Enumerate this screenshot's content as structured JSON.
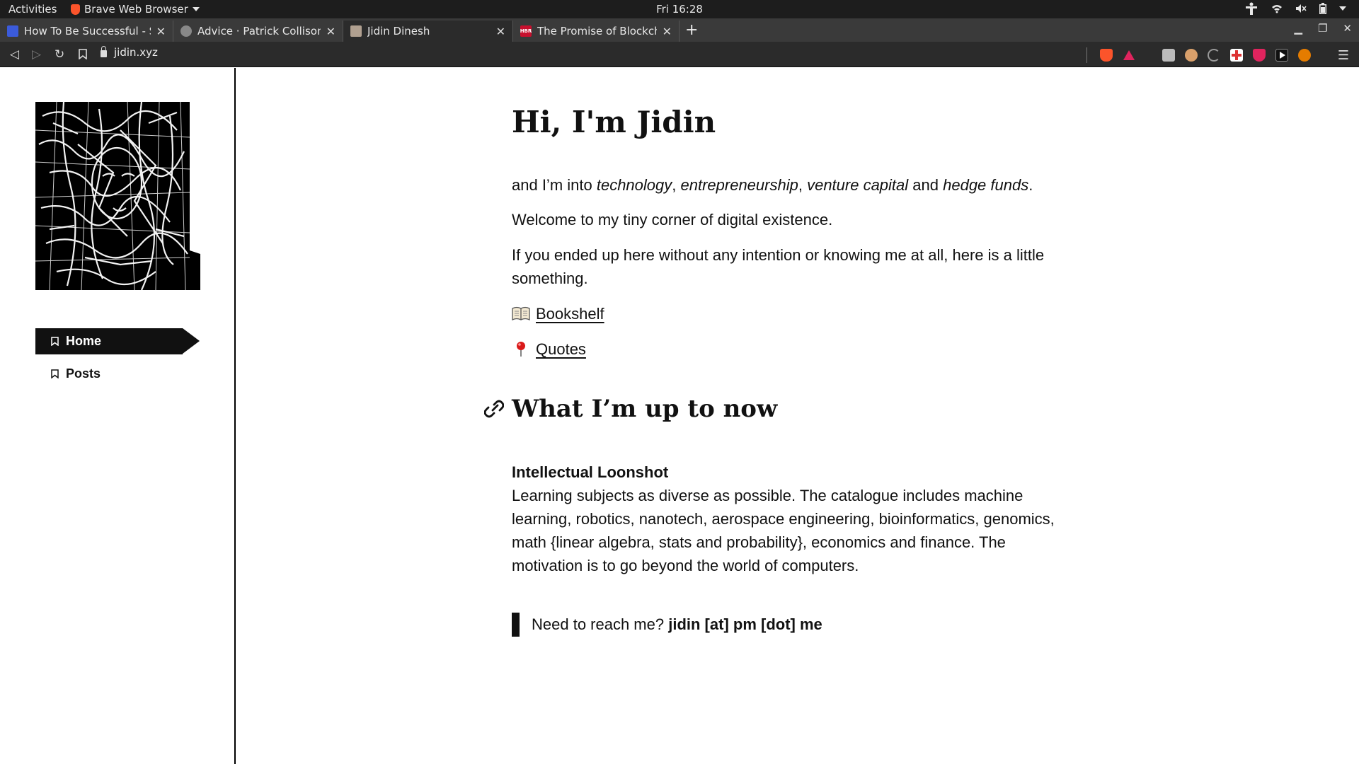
{
  "system_bar": {
    "activities": "Activities",
    "app_name": "Brave Web Browser",
    "clock": "Fri 16:28"
  },
  "tabs": [
    {
      "title": "How To Be Successful - Sam",
      "favicon_color": "#3b5bdb",
      "active": false
    },
    {
      "title": "Advice · Patrick Collison",
      "favicon_color": "#888888",
      "active": false
    },
    {
      "title": "Jidin Dinesh",
      "favicon_color": "#b0a090",
      "active": true
    },
    {
      "title": "The Promise of Blockchain",
      "favicon_color": "#c8102e",
      "favicon_text": "HBR",
      "active": false
    }
  ],
  "toolbar": {
    "url": "jidin.xyz"
  },
  "sidebar": {
    "nav": [
      {
        "label": "Home",
        "active": true
      },
      {
        "label": "Posts",
        "active": false
      }
    ]
  },
  "main": {
    "heading": "Hi, I'm Jidin",
    "intro": {
      "prefix": "and I’m into ",
      "interest1": "technology",
      "sep1": ", ",
      "interest2": "entrepreneurship",
      "sep2": ", ",
      "interest3": "venture capital",
      "and": " and ",
      "interest4": "hedge funds",
      "suffix": "."
    },
    "welcome": "Welcome to my tiny corner of digital existence.",
    "ended_up": "If you ended up here without any intention or knowing me at all, here is a little something.",
    "links": [
      {
        "label": "Bookshelf",
        "icon": "open-book-emoji"
      },
      {
        "label": "Quotes",
        "icon": "round-pushpin-emoji"
      }
    ],
    "section_heading": "What I’m up to now",
    "project_title": "Intellectual Loonshot",
    "project_body": "Learning subjects as diverse as possible. The catalogue includes machine learning, robotics, nanotech, aerospace engineering, bioinformatics, genomics, math {linear algebra, stats and probability}, economics and finance. The motivation is to go beyond the world of computers.",
    "reach_prefix": "Need to reach me? ",
    "reach_contact": "jidin [at] pm [dot] me"
  },
  "colors": {
    "text": "#111111",
    "chrome_dark": "#2b2b2b",
    "brave_orange": "#fb542b"
  }
}
